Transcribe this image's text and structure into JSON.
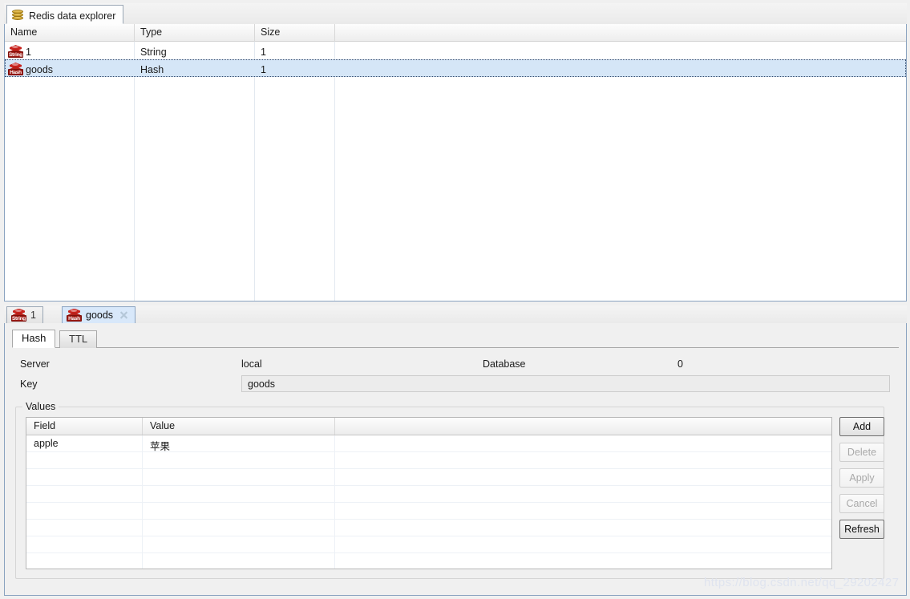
{
  "window": {
    "main_tab": {
      "label": "Redis data explorer",
      "icon": "database-icon"
    }
  },
  "key_table": {
    "columns": [
      "Name",
      "Type",
      "Size"
    ],
    "rows": [
      {
        "icon": "redis-string-icon",
        "icon_label": "String",
        "name": "1",
        "type": "String",
        "size": "1",
        "selected": false
      },
      {
        "icon": "redis-hash-icon",
        "icon_label": "Hash",
        "name": "goods",
        "type": "Hash",
        "size": "1",
        "selected": true
      }
    ]
  },
  "detail_tabs": [
    {
      "label": "1",
      "icon_label": "String",
      "active": false,
      "closable": false
    },
    {
      "label": "goods",
      "icon_label": "Hash",
      "active": true,
      "closable": true,
      "close_icon": "close-icon"
    }
  ],
  "sub_tabs": [
    {
      "label": "Hash",
      "active": true
    },
    {
      "label": "TTL",
      "active": false
    }
  ],
  "form": {
    "server_label": "Server",
    "server_value": "local",
    "database_label": "Database",
    "database_value": "0",
    "key_label": "Key",
    "key_value": "goods"
  },
  "values_group": {
    "title": "Values",
    "columns": [
      "Field",
      "Value"
    ],
    "rows": [
      {
        "field": "apple",
        "value": "苹果"
      }
    ],
    "empty_rows": 7
  },
  "buttons": [
    {
      "label": "Add",
      "enabled": true
    },
    {
      "label": "Delete",
      "enabled": false
    },
    {
      "label": "Apply",
      "enabled": false
    },
    {
      "label": "Cancel",
      "enabled": false
    },
    {
      "label": "Refresh",
      "enabled": true
    }
  ],
  "watermark": "https://blog.csdn.net/qq_29202427",
  "colors": {
    "selection": "#d5e6f7",
    "tab_active": "#d8e8fa",
    "panel_border": "#8aa3c0",
    "redis_red": "#c8221c",
    "db_gold": "#c79a22"
  }
}
